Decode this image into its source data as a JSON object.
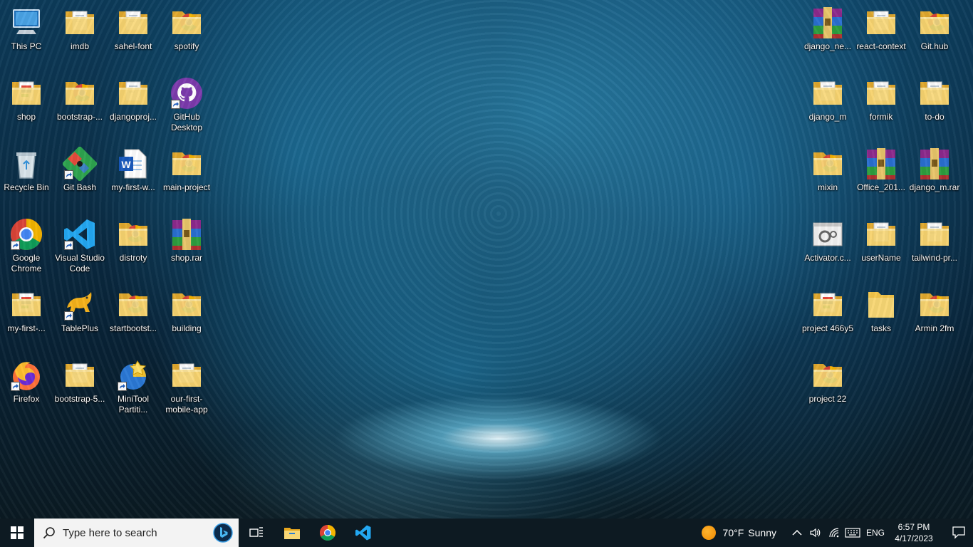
{
  "desktop": {
    "icons_left": [
      {
        "label": "This PC",
        "icon": "computer-icon",
        "type": "pc"
      },
      {
        "label": "imdb",
        "icon": "folder-icon",
        "type": "folder"
      },
      {
        "label": "sahel-font",
        "icon": "folder-icon",
        "type": "folder"
      },
      {
        "label": "spotify",
        "icon": "folder-icon",
        "type": "folder-chrome"
      },
      {
        "label": "shop",
        "icon": "folder-icon",
        "type": "folder-doc"
      },
      {
        "label": "bootstrap-...",
        "icon": "folder-chrome-icon",
        "type": "folder-chrome"
      },
      {
        "label": "djangoproj...",
        "icon": "folder-icon",
        "type": "folder"
      },
      {
        "label": "GitHub Desktop",
        "icon": "github-icon",
        "type": "github",
        "shortcut": true
      },
      {
        "label": "Recycle Bin",
        "icon": "recycle-bin-icon",
        "type": "recycle"
      },
      {
        "label": "Git Bash",
        "icon": "git-bash-icon",
        "type": "gitbash",
        "shortcut": true
      },
      {
        "label": "my-first-w...",
        "icon": "word-document-icon",
        "type": "word"
      },
      {
        "label": "main-project",
        "icon": "folder-chrome-icon",
        "type": "folder-chrome"
      },
      {
        "label": "Google Chrome",
        "icon": "chrome-icon",
        "type": "chrome",
        "shortcut": true
      },
      {
        "label": "Visual Studio Code",
        "icon": "vscode-icon",
        "type": "vscode",
        "shortcut": true
      },
      {
        "label": "distroty",
        "icon": "folder-chrome-icon",
        "type": "folder-chrome"
      },
      {
        "label": "shop.rar",
        "icon": "winrar-icon",
        "type": "rar"
      },
      {
        "label": "my-first-...",
        "icon": "folder-icon",
        "type": "folder-doc"
      },
      {
        "label": "TablePlus",
        "icon": "tableplus-icon",
        "type": "tableplus",
        "shortcut": true
      },
      {
        "label": "startbootst...",
        "icon": "folder-chrome-icon",
        "type": "folder-chrome"
      },
      {
        "label": "building",
        "icon": "folder-chrome-icon",
        "type": "folder-chrome"
      },
      {
        "label": "Firefox",
        "icon": "firefox-icon",
        "type": "firefox",
        "shortcut": true
      },
      {
        "label": "bootstrap-5...",
        "icon": "folder-icon",
        "type": "folder"
      },
      {
        "label": "MiniTool Partiti...",
        "icon": "minitool-icon",
        "type": "minitool",
        "shortcut": true
      },
      {
        "label": "our-first-mobile-app",
        "icon": "folder-icon",
        "type": "folder"
      }
    ],
    "icons_right": [
      {
        "label": "django_ne...",
        "icon": "winrar-icon",
        "type": "rar"
      },
      {
        "label": "react-context",
        "icon": "folder-icon",
        "type": "folder"
      },
      {
        "label": "Git.hub",
        "icon": "folder-chrome-icon",
        "type": "folder-chrome"
      },
      {
        "label": "django_m",
        "icon": "folder-icon",
        "type": "folder"
      },
      {
        "label": "formik",
        "icon": "folder-icon",
        "type": "folder"
      },
      {
        "label": "to-do",
        "icon": "folder-icon",
        "type": "folder"
      },
      {
        "label": "mixin",
        "icon": "folder-chrome-icon",
        "type": "folder-chrome"
      },
      {
        "label": "Office_201...",
        "icon": "winrar-icon",
        "type": "rar"
      },
      {
        "label": "django_m.rar",
        "icon": "winrar-icon",
        "type": "rar"
      },
      {
        "label": "Activator.c...",
        "icon": "settings-file-icon",
        "type": "activator"
      },
      {
        "label": "userName",
        "icon": "folder-icon",
        "type": "folder"
      },
      {
        "label": "tailwind-pr...",
        "icon": "folder-icon",
        "type": "folder"
      },
      {
        "label": "project 466y5",
        "icon": "folder-icon",
        "type": "folder-doc"
      },
      {
        "label": "tasks",
        "icon": "folder-icon",
        "type": "folder-plain"
      },
      {
        "label": "Armin 2fm",
        "icon": "folder-chrome-icon",
        "type": "folder-chrome"
      },
      {
        "label": "project 22",
        "icon": "folder-chrome-icon",
        "type": "folder-chrome"
      }
    ]
  },
  "taskbar": {
    "search_placeholder": "Type here to search",
    "pinned": [
      "file-explorer-icon",
      "chrome-icon",
      "vscode-icon"
    ],
    "weather_temp": "70°F",
    "weather_text": "Sunny",
    "language": "ENG",
    "time": "6:57 PM",
    "date": "4/17/2023"
  },
  "colors": {
    "taskbar_bg": "#0d1a22",
    "folder_yellow": "#f8d775",
    "accent_blue": "#76b9ed"
  }
}
